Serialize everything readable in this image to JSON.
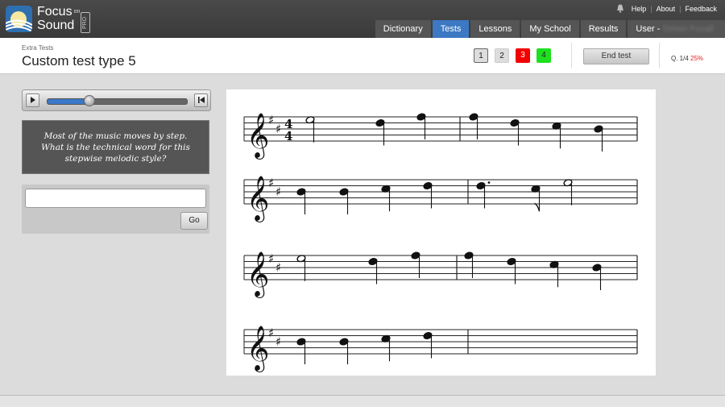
{
  "brand": {
    "line1": "Focus",
    "on": "on",
    "line2": "Sound",
    "badge": "PRO"
  },
  "toplinks": [
    "Help",
    "About",
    "Feedback"
  ],
  "nav": [
    {
      "label": "Dictionary",
      "active": false
    },
    {
      "label": "Tests",
      "active": true
    },
    {
      "label": "Lessons",
      "active": false
    },
    {
      "label": "My School",
      "active": false
    },
    {
      "label": "Results",
      "active": false
    }
  ],
  "user": {
    "prefix": "User - ",
    "name": "Simon Foxall"
  },
  "header": {
    "breadcrumb": "Extra Tests",
    "title": "Custom test type 5",
    "questions": [
      "1",
      "2",
      "3",
      "4"
    ],
    "end_test": "End test",
    "progress_label": "Q. 1/4",
    "progress_pct": "25%"
  },
  "player": {
    "position": 0.3
  },
  "question_text": "Most of the music moves by step. What is the technical word for this stepwise melodic style?",
  "answer": {
    "value": "",
    "placeholder": ""
  },
  "go_label": "Go",
  "score": {
    "clef": "treble",
    "key_signature": "2 sharps",
    "time_signature": "4/4",
    "systems": 4
  },
  "colors": {
    "accent": "#3c78c3",
    "wrong": "#f20000",
    "right": "#1fe01f"
  }
}
